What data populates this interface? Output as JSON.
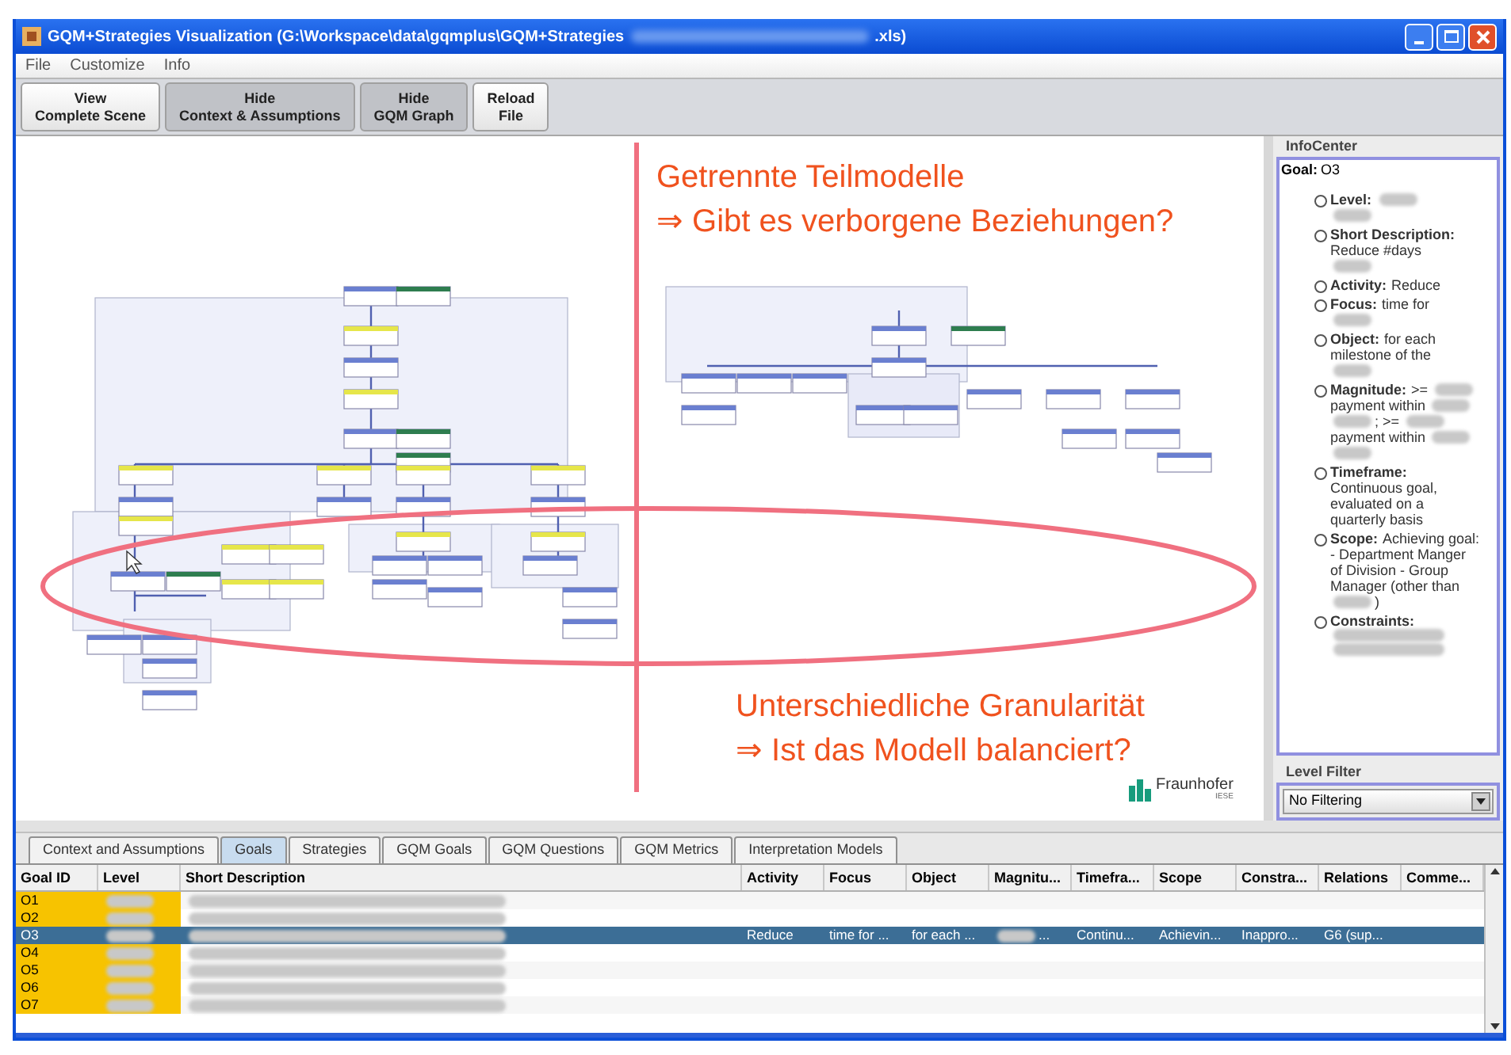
{
  "window": {
    "title_start": "GQM+Strategies Visualization (G:\\Workspace\\data\\gqmplus\\GQM+Strategies",
    "title_end": ".xls)"
  },
  "menu": [
    "File",
    "Customize",
    "Info"
  ],
  "toolbar": [
    {
      "line1": "View",
      "line2": "Complete Scene",
      "pressed": false
    },
    {
      "line1": "Hide",
      "line2": "Context & Assumptions",
      "pressed": true
    },
    {
      "line1": "Hide",
      "line2": "GQM Graph",
      "pressed": true
    },
    {
      "line1": "Reload",
      "line2": "File",
      "pressed": false
    }
  ],
  "annotations": {
    "top": [
      "Getrennte Teilmodelle",
      "⇒ Gibt es verborgene Beziehungen?"
    ],
    "bottom": [
      "Unterschiedliche Granularität",
      "⇒ Ist das Modell balanciert?"
    ]
  },
  "logo": {
    "name": "Fraunhofer",
    "sub": "IESE"
  },
  "info_center": {
    "title": "InfoCenter",
    "goal_label": "Goal:",
    "goal_value": "O3",
    "items": [
      {
        "label": "Level:",
        "lines": [
          [
            {
              "kind": "blur"
            }
          ],
          [
            {
              "kind": "blur"
            }
          ]
        ]
      },
      {
        "label": "Short Description:",
        "lines": [
          [
            {
              "kind": "text",
              "text": "Reduce #days"
            }
          ],
          [
            {
              "kind": "blur"
            }
          ]
        ]
      },
      {
        "label": "Activity:",
        "lines": [
          [
            {
              "kind": "text",
              "text": "Reduce"
            }
          ]
        ]
      },
      {
        "label": "Focus:",
        "lines": [
          [
            {
              "kind": "text",
              "text": "time for"
            }
          ],
          [
            {
              "kind": "blur"
            }
          ]
        ]
      },
      {
        "label": "Object:",
        "lines": [
          [
            {
              "kind": "text",
              "text": "for each"
            }
          ],
          [
            {
              "kind": "text",
              "text": "milestone of the"
            }
          ],
          [
            {
              "kind": "blur"
            }
          ]
        ]
      },
      {
        "label": "Magnitude:",
        "lines": [
          [
            {
              "kind": "text",
              "text": ">="
            },
            {
              "kind": "blur"
            }
          ],
          [
            {
              "kind": "text",
              "text": "payment within"
            },
            {
              "kind": "blur"
            }
          ],
          [
            {
              "kind": "blur"
            },
            {
              "kind": "text",
              "text": "; >="
            },
            {
              "kind": "blur"
            }
          ],
          [
            {
              "kind": "text",
              "text": "payment within"
            },
            {
              "kind": "blur"
            }
          ],
          [
            {
              "kind": "blur"
            }
          ]
        ]
      },
      {
        "label": "Timeframe:",
        "lines": [
          [
            {
              "kind": "text",
              "text": "Continuous goal,"
            }
          ],
          [
            {
              "kind": "text",
              "text": "evaluated on a"
            }
          ],
          [
            {
              "kind": "text",
              "text": "quarterly basis"
            }
          ]
        ]
      },
      {
        "label": "Scope:",
        "lines": [
          [
            {
              "kind": "text",
              "text": "Achieving goal:"
            }
          ],
          [
            {
              "kind": "text",
              "text": "- Department Manger"
            }
          ],
          [
            {
              "kind": "text",
              "text": "of Division - Group"
            }
          ],
          [
            {
              "kind": "text",
              "text": "Manager (other than"
            }
          ],
          [
            {
              "kind": "blur"
            },
            {
              "kind": "text",
              "text": ")"
            }
          ]
        ]
      },
      {
        "label": "Constraints:",
        "lines": [
          [
            {
              "kind": "blurline"
            }
          ],
          [
            {
              "kind": "blurline"
            }
          ]
        ]
      }
    ]
  },
  "level_filter": {
    "label": "Level Filter",
    "value": "No Filtering"
  },
  "tabs": [
    {
      "label": "Context and Assumptions",
      "selected": false
    },
    {
      "label": "Goals",
      "selected": true
    },
    {
      "label": "Strategies",
      "selected": false
    },
    {
      "label": "GQM Goals",
      "selected": false
    },
    {
      "label": "GQM Questions",
      "selected": false
    },
    {
      "label": "GQM Metrics",
      "selected": false
    },
    {
      "label": "Interpretation Models",
      "selected": false
    }
  ],
  "table": {
    "columns": [
      "Goal ID",
      "Level",
      "Short Description",
      "Activity",
      "Focus",
      "Object",
      "Magnitu...",
      "Timefra...",
      "Scope",
      "Constra...",
      "Relations",
      "Comme..."
    ],
    "rows": [
      {
        "selected": false,
        "cells": [
          {
            "kind": "text",
            "text": "O1"
          },
          {
            "kind": "blur"
          },
          {
            "kind": "blur"
          }
        ]
      },
      {
        "selected": false,
        "cells": [
          {
            "kind": "text",
            "text": "O2"
          },
          {
            "kind": "blur"
          },
          {
            "kind": "blur"
          }
        ]
      },
      {
        "selected": true,
        "cells": [
          {
            "kind": "text",
            "text": "O3"
          },
          {
            "kind": "blur"
          },
          {
            "kind": "blur"
          },
          {
            "kind": "text",
            "text": "Reduce"
          },
          {
            "kind": "text",
            "text": "time for ..."
          },
          {
            "kind": "text",
            "text": "for each ..."
          },
          {
            "kind": "blurtext",
            "text": "..."
          },
          {
            "kind": "text",
            "text": "Continu..."
          },
          {
            "kind": "text",
            "text": "Achievin..."
          },
          {
            "kind": "text",
            "text": "Inappro..."
          },
          {
            "kind": "text",
            "text": "G6 (sup..."
          }
        ]
      },
      {
        "selected": false,
        "cells": [
          {
            "kind": "text",
            "text": "O4"
          },
          {
            "kind": "blur"
          },
          {
            "kind": "blur"
          }
        ]
      },
      {
        "selected": false,
        "cells": [
          {
            "kind": "text",
            "text": "O5"
          },
          {
            "kind": "blur"
          },
          {
            "kind": "blur"
          }
        ]
      },
      {
        "selected": false,
        "cells": [
          {
            "kind": "text",
            "text": "O6"
          },
          {
            "kind": "blur"
          },
          {
            "kind": "blur"
          }
        ]
      },
      {
        "selected": false,
        "cells": [
          {
            "kind": "text",
            "text": "O7"
          },
          {
            "kind": "blur"
          },
          {
            "kind": "blur"
          }
        ]
      }
    ]
  }
}
